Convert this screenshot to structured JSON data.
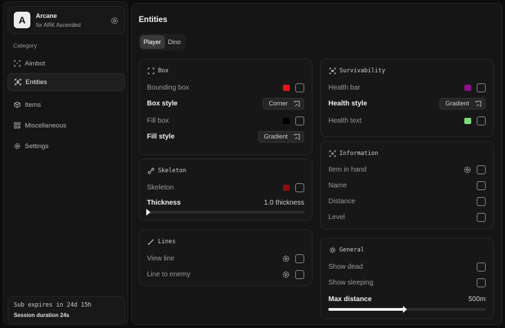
{
  "brand": {
    "name": "Arcane",
    "subtitle": "for ARK Ascended",
    "logo_letter": "A"
  },
  "sidebar": {
    "category_label": "Category",
    "items": [
      {
        "label": "Aimbot",
        "icon": "crosshair-icon"
      },
      {
        "label": "Entities",
        "icon": "scan-user-icon",
        "active": true
      },
      {
        "label": "Items",
        "icon": "cube-icon"
      },
      {
        "label": "Miscellaneous",
        "icon": "grid-icon"
      },
      {
        "label": "Settings",
        "icon": "gear-icon"
      }
    ],
    "subscription": "Sub expires in 24d 15h",
    "session": "Session duration 24s"
  },
  "main": {
    "title": "Entities",
    "tabs": [
      {
        "label": "Player",
        "active": true
      },
      {
        "label": "Dino"
      }
    ]
  },
  "box_card": {
    "title": "Box",
    "bounding_box_label": "Bounding box",
    "bounding_box_color": "#e81212",
    "box_style_label": "Box style",
    "box_style_value": "Corner",
    "fill_box_label": "Fill box",
    "fill_box_color": "#000000",
    "fill_style_label": "Fill style",
    "fill_style_value": "Gradient"
  },
  "skeleton_card": {
    "title": "Skeleton",
    "skeleton_label": "Skeleton",
    "skeleton_color": "#8a0e0e",
    "thickness_label": "Thickness",
    "thickness_value": "1.0 thickness",
    "thickness_fraction": 0.0
  },
  "lines_card": {
    "title": "Lines",
    "view_line_label": "View line",
    "line_to_enemy_label": "Line to enemy"
  },
  "survivability_card": {
    "title": "Survivability",
    "health_bar_label": "Health bar",
    "health_bar_color": "#8a118a",
    "health_style_label": "Health style",
    "health_style_value": "Gradient",
    "health_text_label": "Health text",
    "health_text_color": "#7ee07a"
  },
  "information_card": {
    "title": "Information",
    "item_in_hand_label": "Item in hand",
    "name_label": "Name",
    "distance_label": "Distance",
    "level_label": "Level"
  },
  "general_card": {
    "title": "General",
    "show_dead_label": "Show dead",
    "show_sleeping_label": "Show sleeping",
    "max_distance_label": "Max distance",
    "max_distance_value": "500m",
    "max_distance_fraction": 0.48
  }
}
